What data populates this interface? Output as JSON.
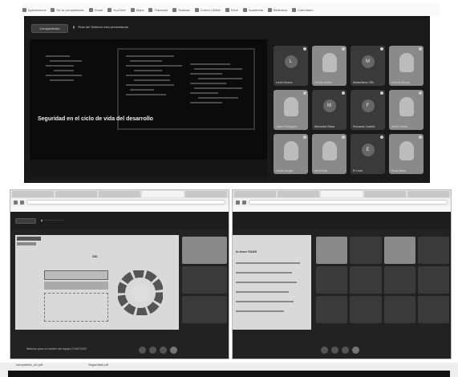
{
  "bookmarks": [
    "Aplicaciones",
    "De tu computadora",
    "Gmail",
    "YouTube",
    "Maps",
    "Traductor",
    "Noticias",
    "Correo UNAM",
    "Drive",
    "Academia",
    "Biblioteca",
    "Calendario"
  ],
  "main": {
    "share_button": "Compartiendo",
    "share_title": "Ruta del Webinar está presentando",
    "slide_title": "Seguridad en el ciclo de vida del desarrollo",
    "participants": [
      {
        "name": "Lenel Guerra",
        "type": "avatar",
        "initial": "L"
      },
      {
        "name": "Cecilia Antolín",
        "type": "camera"
      },
      {
        "name": "Maximiliano CRL",
        "type": "avatar",
        "initial": "M"
      },
      {
        "name": "Cinthya Reyes",
        "type": "camera"
      },
      {
        "name": "Javier Rodríguez",
        "type": "camera"
      },
      {
        "name": "Mercedes Rivas",
        "type": "avatar",
        "initial": "M"
      },
      {
        "name": "Fernando Castillo",
        "type": "avatar",
        "initial": "F"
      },
      {
        "name": "Emilio Torres",
        "type": "camera"
      },
      {
        "name": "Ulises Vargas",
        "type": "camera"
      },
      {
        "name": "Ana Paula",
        "type": "camera"
      },
      {
        "name": "El León",
        "type": "avatar",
        "initial": "E"
      },
      {
        "name": "Rosa María",
        "type": "camera"
      }
    ]
  },
  "left_panel": {
    "slide_heading": "SSI",
    "footer_text": "Webinar para mi nombre del equipo CHAT/2020"
  },
  "right_panel": {
    "slide_heading": "lo-hace SANS"
  },
  "downloads": [
    "compartido_uh.pdf",
    "Seguridad.pdf"
  ]
}
